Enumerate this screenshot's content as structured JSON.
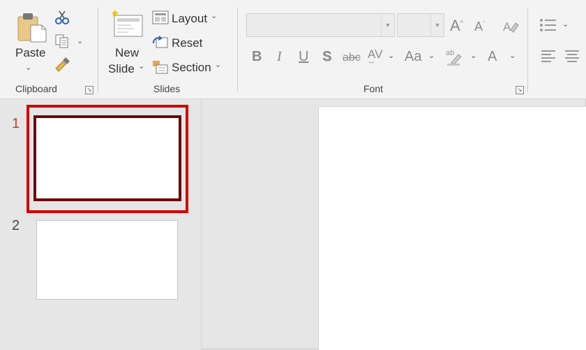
{
  "clipboard": {
    "paste_label": "Paste",
    "group_label": "Clipboard"
  },
  "slides": {
    "new_slide_line1": "New",
    "new_slide_line2": "Slide",
    "layout_label": "Layout",
    "reset_label": "Reset",
    "section_label": "Section",
    "group_label": "Slides"
  },
  "font": {
    "group_label": "Font",
    "font_name_value": "",
    "font_size_value": "",
    "increase_size_glyph": "A",
    "decrease_size_glyph": "A",
    "bold_glyph": "B",
    "italic_glyph": "I",
    "underline_glyph": "U",
    "shadow_glyph": "S",
    "strikethrough_glyph": "abc",
    "spacing_glyph": "AV",
    "case_glyph": "Aa",
    "font_color_glyph": "A"
  },
  "thumbnails": [
    {
      "number": "1",
      "selected": true
    },
    {
      "number": "2",
      "selected": false
    }
  ],
  "colors": {
    "highlight_red": "#d40000",
    "selected_border": "#6b0a0a",
    "slide_number_active": "#b7472a"
  }
}
